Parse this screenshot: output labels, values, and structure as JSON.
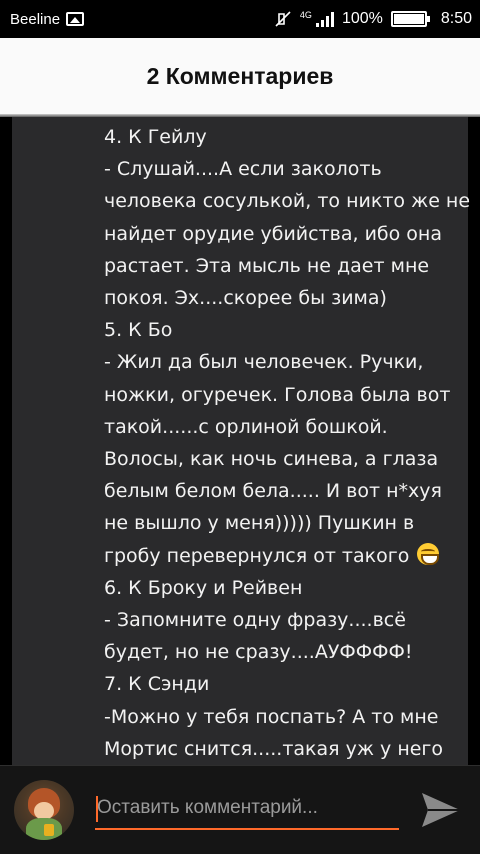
{
  "status_bar": {
    "carrier": "Beeline",
    "network": "4G",
    "battery_percent": "100%",
    "time": "8:50",
    "icons": [
      "picture-icon",
      "mute-icon",
      "signal-icon",
      "battery-icon"
    ]
  },
  "header": {
    "title": "2 Комментариев"
  },
  "comment": {
    "lines": [
      "4. К Гейлу",
      "- Слушай....А если заколоть",
      "человека сосулькой, то никто же не",
      "найдет орудие убийства, ибо она",
      "растает. Эта мысль не дает мне",
      "покоя. Эх....скорее бы зима)",
      "5. К Бо",
      "- Жил да был человечек. Ручки,",
      "ножки, огуречек. Голова была вот",
      "такой......с орлиной бошкой.",
      "Волосы, как ночь синева, а глаза",
      "белым белом бела..... И вот н*хуя",
      "не вышло у меня))))) Пушкин в",
      "гробу перевернулся от такого",
      "6. К Броку и Рейвен",
      "- Запомните одну фразу....всё",
      "будет, но не сразу....АУФФФФ!",
      "7. К Сэнди",
      "-Можно у тебя поспать? А то мне",
      "Мортис снится.....такая уж у него"
    ],
    "emoji": "grinning-face-icon"
  },
  "composer": {
    "placeholder": "Оставить комментарий...",
    "avatar": "user-avatar",
    "send_icon": "send-icon"
  },
  "colors": {
    "accent": "#ff6a2b",
    "card_bg": "#2a2a2c",
    "header_bg": "#fafafa"
  }
}
